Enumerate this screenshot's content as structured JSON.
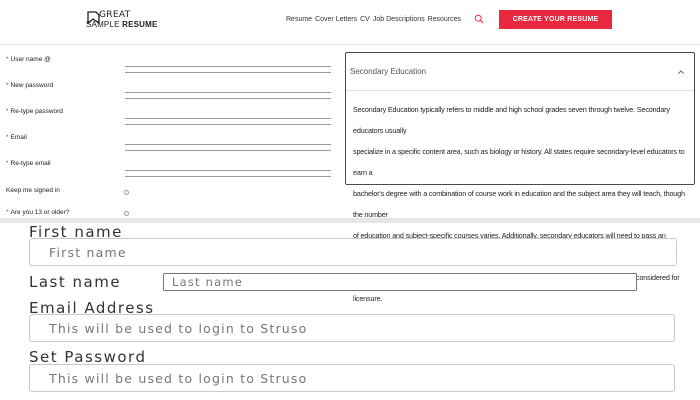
{
  "header": {
    "logo": {
      "line1": "GREAT",
      "line2_light": "SAMPLE",
      "line2_bold": "RESUME"
    },
    "nav": [
      "Resume",
      "Cover Letters",
      "CV",
      "Job Descriptions",
      "Resources"
    ],
    "cta_label": "CREATE YOUR RESUME",
    "accent_color": "#e8283e"
  },
  "account_form": {
    "fields": [
      {
        "label": "User name",
        "required": true,
        "suffix": "@"
      },
      {
        "label": "New password",
        "required": true
      },
      {
        "label": "Re-type password",
        "required": true
      },
      {
        "label": "Email",
        "required": true
      },
      {
        "label": "Re-type email",
        "required": true
      }
    ],
    "keep_signed_in": "Keep me signed in",
    "age_check": "Are you 13 or older?"
  },
  "accordion": {
    "title": "Secondary Education",
    "expanded": true,
    "body_lines": [
      "Secondary Education typically refers to middle and high school grades seven through twelve. Secondary educators usually",
      "specialize in a specific content area, such as biology or history. All states require secondary-level educators to earn a",
      "bachelor's degree with a combination of course work in education and the subject area they will teach, though the number",
      "of education and subject-specific courses varies. Additionally, secondary educators will need to pass an education program",
      "entrance exam, a pedagogy knowledge exam, and one or more subject-specific exams to be considered for licensure."
    ]
  },
  "registration": {
    "first_name": {
      "label": "First name",
      "placeholder": "First name"
    },
    "last_name": {
      "label": "Last name",
      "placeholder": "Last name"
    },
    "email": {
      "label": "Email Address",
      "placeholder": "This will be used to login to Struso"
    },
    "password": {
      "label": "Set Password",
      "placeholder": "This will be used to login to Struso"
    }
  }
}
